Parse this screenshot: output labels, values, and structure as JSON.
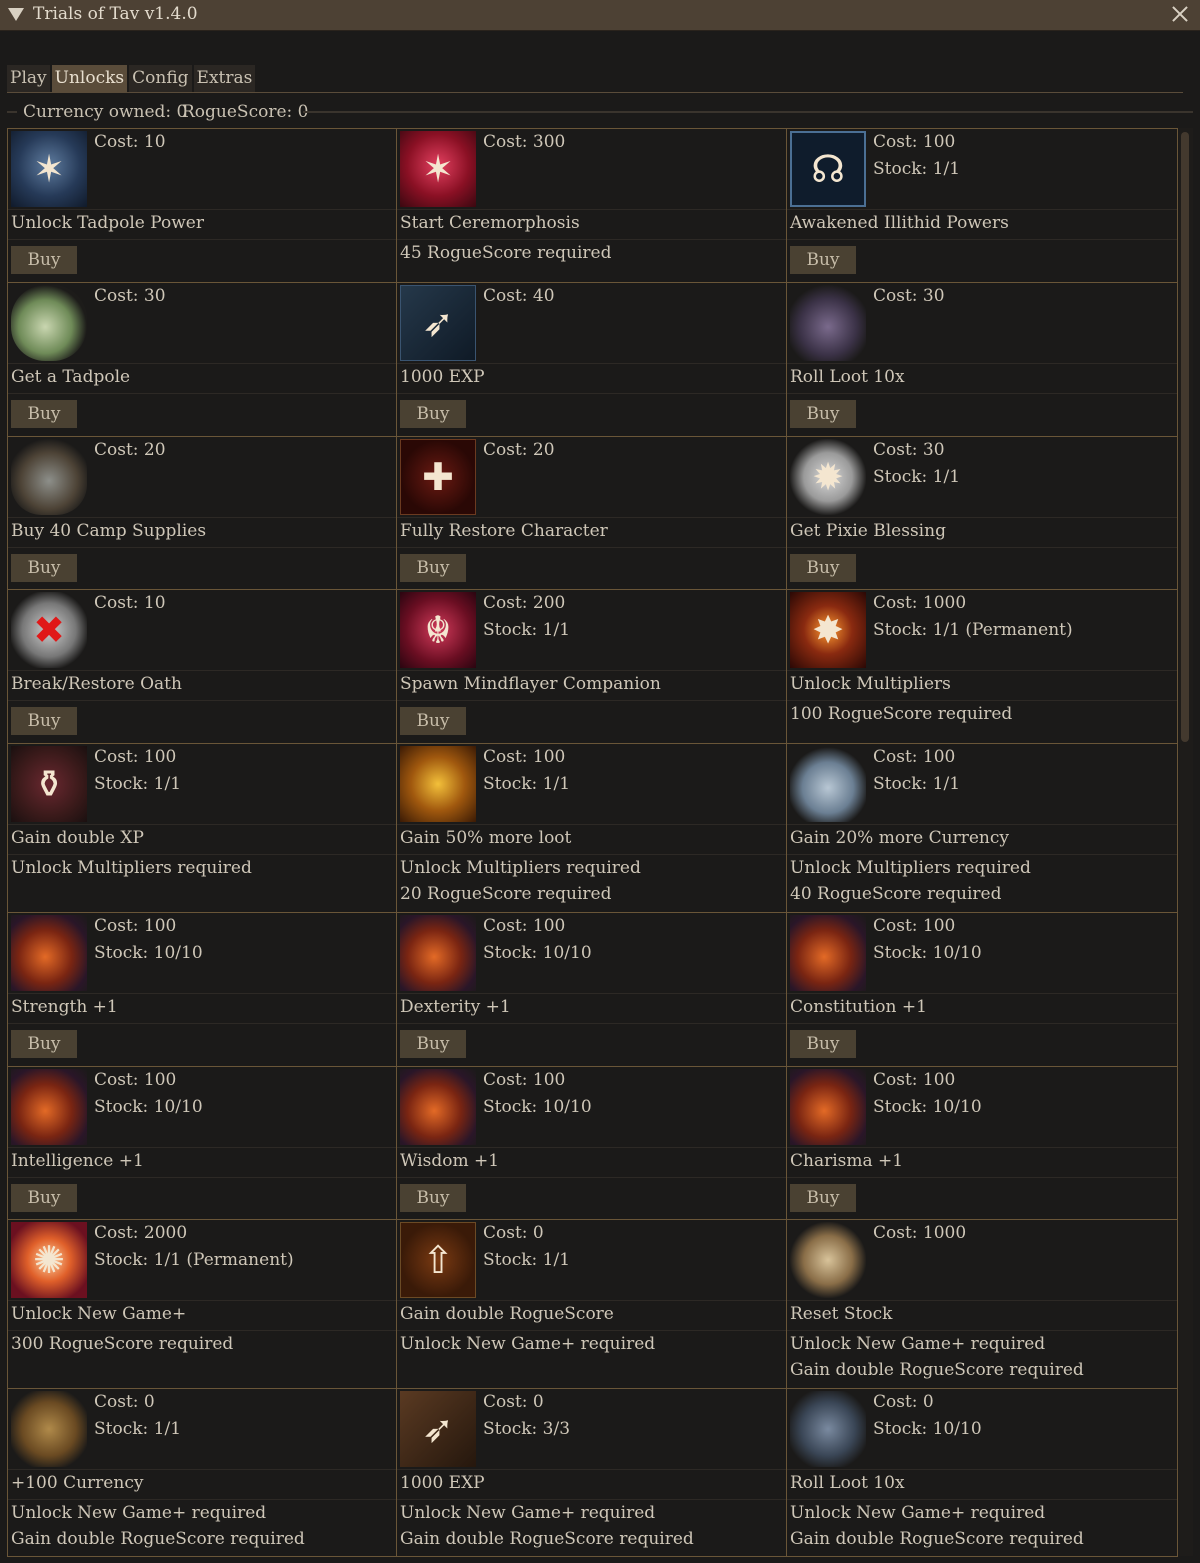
{
  "window": {
    "title": "Trials of Tav v1.4.0"
  },
  "tabs": [
    {
      "label": "Play"
    },
    {
      "label": "Unlocks"
    },
    {
      "label": "Config"
    },
    {
      "label": "Extras"
    }
  ],
  "status": {
    "currency": "Currency owned: 0",
    "roguescore": "RogueScore: 0"
  },
  "buy_label": "Buy",
  "items": [
    {
      "icon": "tadpole-power-icon",
      "cost": "Cost: 10",
      "name": "Unlock Tadpole Power",
      "buy": true
    },
    {
      "icon": "ceremorphosis-icon",
      "cost": "Cost: 300",
      "name": "Start Ceremorphosis",
      "req": "45 RogueScore required"
    },
    {
      "icon": "illithid-brain-icon",
      "cost": "Cost: 100",
      "stock": "Stock: 1/1",
      "name": "Awakened Illithid Powers",
      "buy": true
    },
    {
      "icon": "tadpole-jar-icon",
      "cost": "Cost: 30",
      "name": "Get a Tadpole",
      "buy": true
    },
    {
      "icon": "exp-boot-icon",
      "cost": "Cost: 40",
      "name": "1000 EXP",
      "buy": true
    },
    {
      "icon": "loot-chest-icon",
      "cost": "Cost: 30",
      "name": "Roll Loot 10x",
      "buy": true
    },
    {
      "icon": "camp-supplies-icon",
      "cost": "Cost: 20",
      "name": "Buy 40 Camp Supplies",
      "buy": true
    },
    {
      "icon": "restore-cross-icon",
      "cost": "Cost: 20",
      "name": "Fully Restore Character",
      "buy": true
    },
    {
      "icon": "pixie-shield-icon",
      "cost": "Cost: 30",
      "stock": "Stock: 1/1",
      "name": "Get Pixie Blessing",
      "buy": true
    },
    {
      "icon": "broken-oath-icon",
      "cost": "Cost: 10",
      "name": "Break/Restore Oath",
      "buy": true
    },
    {
      "icon": "mindflayer-icon",
      "cost": "Cost: 200",
      "stock": "Stock: 1/1",
      "name": "Spawn Mindflayer Companion",
      "buy": true
    },
    {
      "icon": "multiplier-burst-icon",
      "cost": "Cost: 1000",
      "stock": "Stock: 1/1 (Permanent)",
      "name": "Unlock Multipliers",
      "req": "100 RogueScore required"
    },
    {
      "icon": "xp-vase-icon",
      "cost": "Cost: 100",
      "stock": "Stock: 1/1",
      "name": "Gain double XP",
      "req": "Unlock Multipliers required"
    },
    {
      "icon": "gold-loot-icon",
      "cost": "Cost: 100",
      "stock": "Stock: 1/1",
      "name": "Gain 50% more loot",
      "req": "Unlock Multipliers required",
      "req2": "20 RogueScore required"
    },
    {
      "icon": "coins-icon",
      "cost": "Cost: 100",
      "stock": "Stock: 1/1",
      "name": "Gain 20% more Currency",
      "req": "Unlock Multipliers required",
      "req2": "40 RogueScore required"
    },
    {
      "icon": "strength-icon",
      "cost": "Cost: 100",
      "stock": "Stock: 10/10",
      "name": "Strength +1",
      "buy": true
    },
    {
      "icon": "dexterity-icon",
      "cost": "Cost: 100",
      "stock": "Stock: 10/10",
      "name": "Dexterity +1",
      "buy": true
    },
    {
      "icon": "constitution-icon",
      "cost": "Cost: 100",
      "stock": "Stock: 10/10",
      "name": "Constitution +1",
      "buy": true
    },
    {
      "icon": "intelligence-icon",
      "cost": "Cost: 100",
      "stock": "Stock: 10/10",
      "name": "Intelligence +1",
      "buy": true
    },
    {
      "icon": "wisdom-icon",
      "cost": "Cost: 100",
      "stock": "Stock: 10/10",
      "name": "Wisdom +1",
      "buy": true
    },
    {
      "icon": "charisma-icon",
      "cost": "Cost: 100",
      "stock": "Stock: 10/10",
      "name": "Charisma +1",
      "buy": true
    },
    {
      "icon": "new-game-plus-icon",
      "cost": "Cost: 2000",
      "stock": "Stock: 1/1 (Permanent)",
      "name": "Unlock New Game+",
      "req": "300 RogueScore required"
    },
    {
      "icon": "up-arrow-icon",
      "cost": "Cost: 0",
      "stock": "Stock: 1/1",
      "name": "Gain double RogueScore",
      "req": "Unlock New Game+ required"
    },
    {
      "icon": "scroll-icon",
      "cost": "Cost: 1000",
      "name": "Reset Stock",
      "req": "Unlock New Game+ required",
      "req2": "Gain double RogueScore required"
    },
    {
      "icon": "treasure-chest-icon",
      "cost": "Cost: 0",
      "stock": "Stock: 1/1",
      "name": "+100 Currency",
      "req": "Unlock New Game+ required",
      "req2": "Gain double RogueScore required"
    },
    {
      "icon": "exp-boot-icon",
      "cost": "Cost: 0",
      "stock": "Stock: 3/3",
      "name": "1000 EXP",
      "req": "Unlock New Game+ required",
      "req2": "Gain double RogueScore required"
    },
    {
      "icon": "loot-chest-icon",
      "cost": "Cost: 0",
      "stock": "Stock: 10/10",
      "name": "Roll Loot 10x",
      "req": "Unlock New Game+ required",
      "req2": "Gain double RogueScore required"
    }
  ]
}
